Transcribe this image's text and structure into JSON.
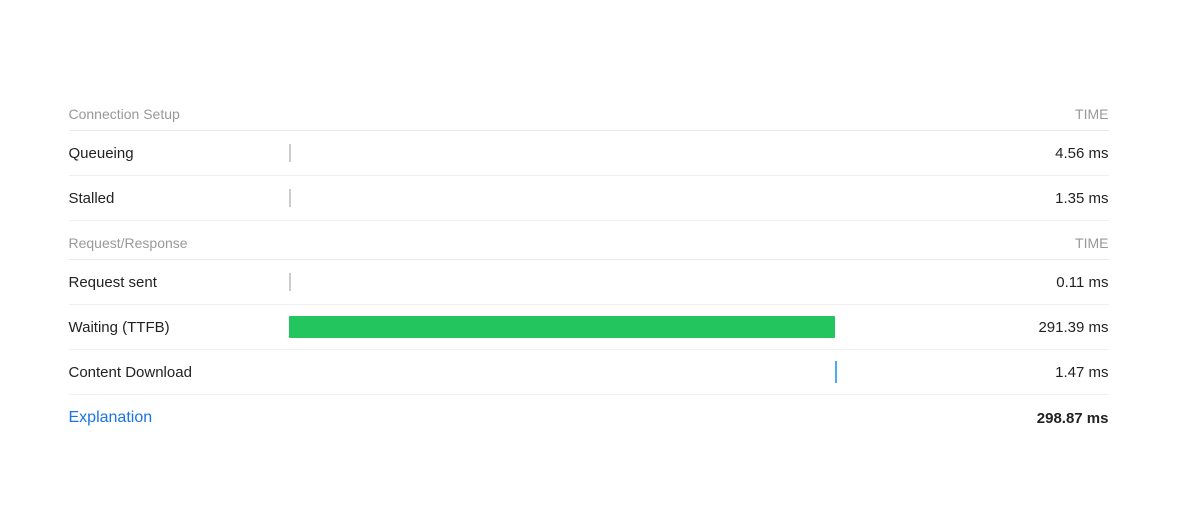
{
  "sections": [
    {
      "id": "connection-setup",
      "label": "Connection Setup",
      "time_label": "TIME",
      "rows": [
        {
          "id": "queueing",
          "label": "Queueing",
          "time": "4.56 ms",
          "bar_type": "tick"
        },
        {
          "id": "stalled",
          "label": "Stalled",
          "time": "1.35 ms",
          "bar_type": "tick"
        }
      ]
    },
    {
      "id": "request-response",
      "label": "Request/Response",
      "time_label": "TIME",
      "rows": [
        {
          "id": "request-sent",
          "label": "Request sent",
          "time": "0.11 ms",
          "bar_type": "tick"
        },
        {
          "id": "waiting-ttfb",
          "label": "Waiting (TTFB)",
          "time": "291.39 ms",
          "bar_type": "green",
          "bar_width_pct": 78
        },
        {
          "id": "content-download",
          "label": "Content Download",
          "time": "1.47 ms",
          "bar_type": "blue",
          "bar_left_pct": 78
        }
      ]
    }
  ],
  "footer": {
    "explanation_label": "Explanation",
    "total_time": "298.87 ms"
  },
  "colors": {
    "section_header": "#999999",
    "row_label": "#222222",
    "tick": "#cccccc",
    "green_bar": "#22c55e",
    "blue_bar": "#4dabf7",
    "explanation": "#1a73e8",
    "total": "#222222"
  }
}
